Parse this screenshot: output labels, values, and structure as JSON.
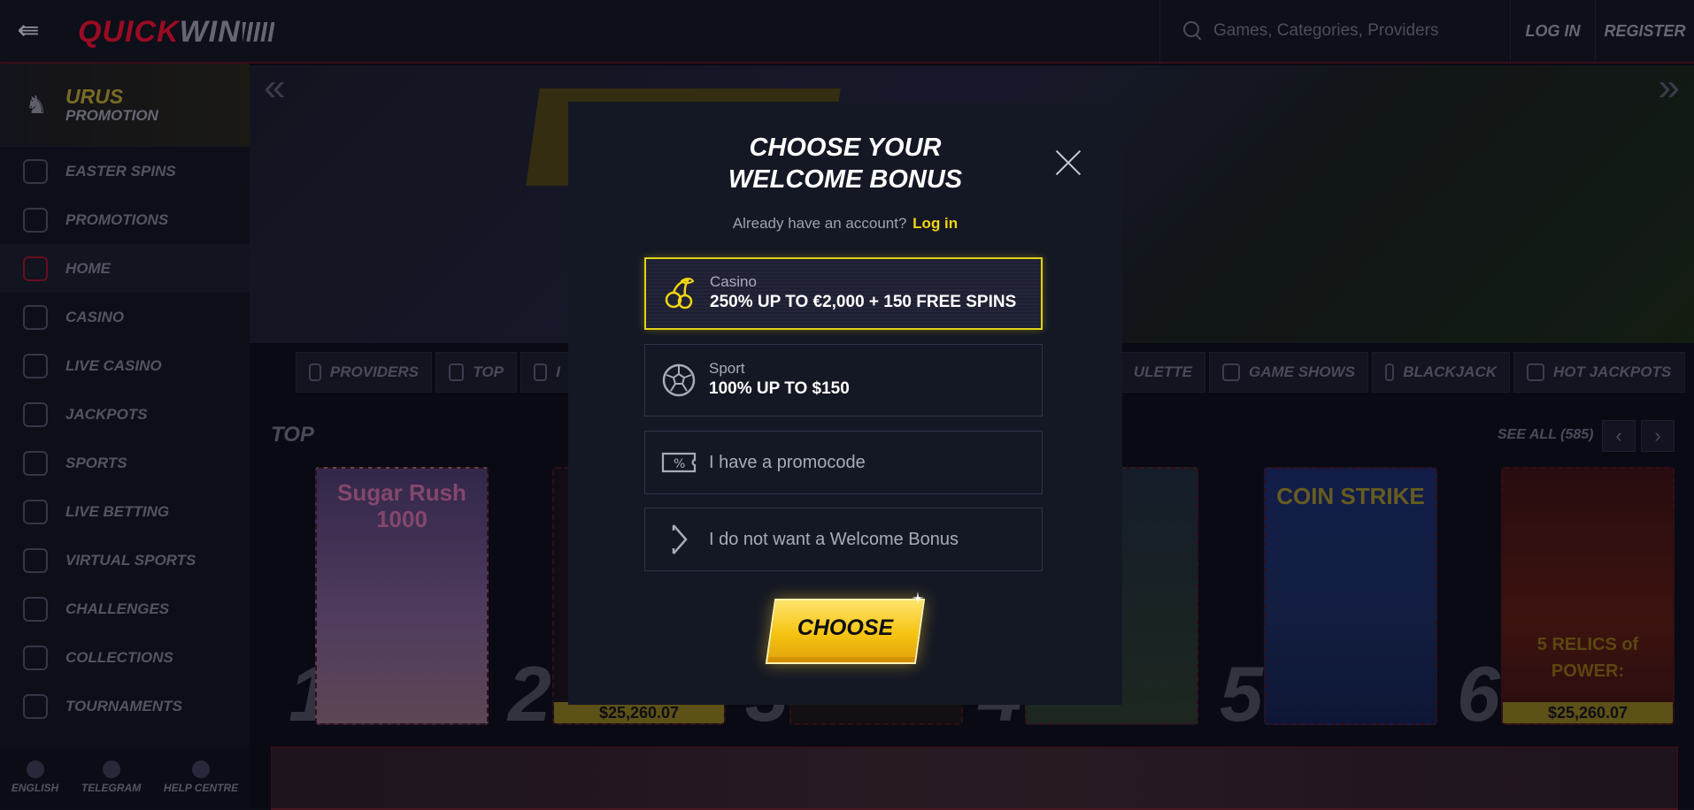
{
  "header": {
    "logo_part1": "QUICK",
    "logo_part2": "WIN",
    "search_placeholder": "Games, Categories, Providers",
    "login_label": "LOG IN",
    "register_label": "REGISTER"
  },
  "sidebar": {
    "promo": {
      "title": "URUS",
      "subtitle": "PROMOTION"
    },
    "items": [
      {
        "label": "EASTER SPINS",
        "icon": "egg-icon"
      },
      {
        "label": "PROMOTIONS",
        "icon": "gift-icon"
      },
      {
        "label": "HOME",
        "icon": "home-icon",
        "active": true
      },
      {
        "label": "CASINO",
        "icon": "slot-machine-icon"
      },
      {
        "label": "LIVE CASINO",
        "icon": "chip-icon"
      },
      {
        "label": "JACKPOTS",
        "icon": "jackpot-icon"
      },
      {
        "label": "SPORTS",
        "icon": "ball-icon"
      },
      {
        "label": "LIVE BETTING",
        "icon": "video-icon"
      },
      {
        "label": "VIRTUAL SPORTS",
        "icon": "gamepad-icon"
      },
      {
        "label": "CHALLENGES",
        "icon": "medal-icon"
      },
      {
        "label": "COLLECTIONS",
        "icon": "cards-icon"
      },
      {
        "label": "TOURNAMENTS",
        "icon": "trophy-icon"
      }
    ],
    "footer": [
      {
        "label": "ENGLISH",
        "icon": "flag-icon"
      },
      {
        "label": "TELEGRAM",
        "icon": "telegram-icon"
      },
      {
        "label": "HELP CENTRE",
        "icon": "help-icon"
      }
    ]
  },
  "categories": [
    {
      "label": "PROVIDERS"
    },
    {
      "label": "TOP"
    },
    {
      "label": "I"
    },
    {
      "label": "ULETTE"
    },
    {
      "label": "GAME SHOWS"
    },
    {
      "label": "BLACKJACK"
    },
    {
      "label": "HOT JACKPOTS"
    }
  ],
  "top_section": {
    "title": "TOP",
    "see_all": "SEE ALL (585)",
    "games": [
      {
        "rank": "1",
        "title": "Sugar Rush 1000",
        "jackpot": ""
      },
      {
        "rank": "2",
        "title": "",
        "jackpot": "$25,260.07"
      },
      {
        "rank": "3",
        "title": "",
        "jackpot": ""
      },
      {
        "rank": "4",
        "title": "",
        "jackpot": ""
      },
      {
        "rank": "5",
        "title": "COIN STRIKE",
        "jackpot": ""
      },
      {
        "rank": "6",
        "title": "5 RELICS of POWER:",
        "jackpot": "$25,260.07"
      }
    ]
  },
  "modal": {
    "title_line1": "CHOOSE YOUR",
    "title_line2": "WELCOME BONUS",
    "account_text": "Already have an account?",
    "login_link": "Log in",
    "options": [
      {
        "label": "Casino",
        "value": "250% UP TO €2,000 + 150 FREE SPINS",
        "icon": "cherries-icon",
        "selected": true
      },
      {
        "label": "Sport",
        "value": "100% UP TO $150",
        "icon": "soccer-ball-icon",
        "selected": false
      },
      {
        "label": "I have a promocode",
        "icon": "promo-ticket-icon",
        "selected": false
      },
      {
        "label": "I do not want a Welcome Bonus",
        "icon": "chevron-right-icon",
        "selected": false
      }
    ],
    "choose_label": "CHOOSE"
  },
  "colors": {
    "accent_yellow": "#f3d513",
    "brand_red": "#e8102e",
    "modal_bg": "#141824"
  }
}
